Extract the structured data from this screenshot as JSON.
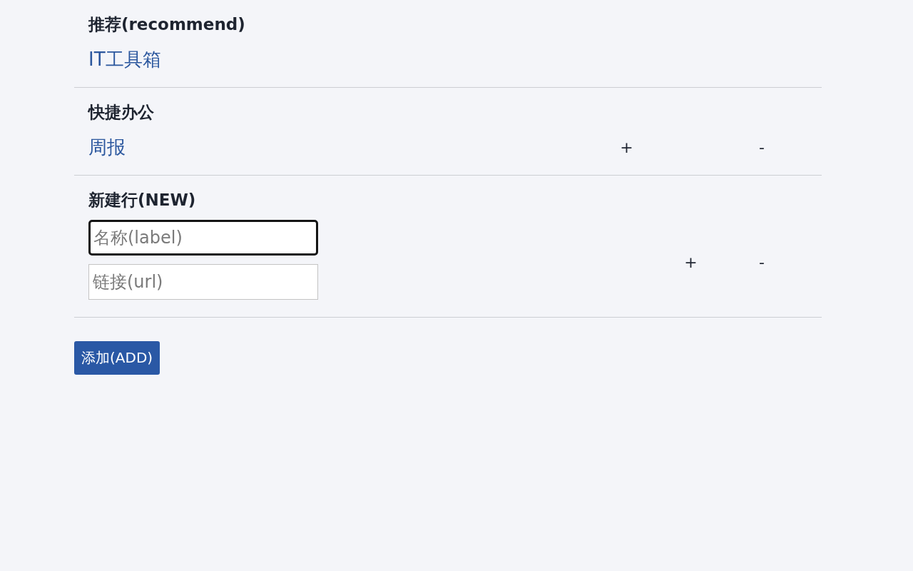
{
  "sections": [
    {
      "heading": "推荐(recommend)",
      "rows": [
        {
          "kind": "link",
          "label": "IT工具箱"
        }
      ]
    },
    {
      "heading": "快捷办公",
      "rows": [
        {
          "kind": "link",
          "label": "周报",
          "plus": "+",
          "minus": "-"
        }
      ]
    },
    {
      "heading": "新建行(NEW)",
      "rows": [
        {
          "kind": "inputs",
          "fields": [
            {
              "placeholder": "名称(label)",
              "focused": true
            },
            {
              "placeholder": "链接(url)",
              "focused": false
            }
          ],
          "plus": "+",
          "minus": "-"
        }
      ]
    }
  ],
  "add_button": "添加(ADD)"
}
